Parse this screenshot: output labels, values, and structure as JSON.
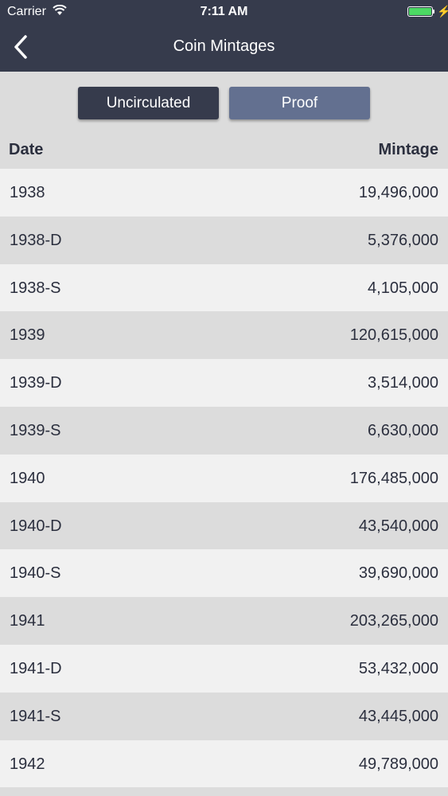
{
  "status": {
    "carrier": "Carrier",
    "time": "7:11 AM"
  },
  "nav": {
    "title": "Coin Mintages"
  },
  "segments": {
    "uncirculated": "Uncirculated",
    "proof": "Proof",
    "selected": "Uncirculated"
  },
  "table": {
    "headers": {
      "date": "Date",
      "mintage": "Mintage"
    },
    "rows": [
      {
        "date": "1938",
        "mintage": "19,496,000"
      },
      {
        "date": "1938-D",
        "mintage": "5,376,000"
      },
      {
        "date": "1938-S",
        "mintage": "4,105,000"
      },
      {
        "date": "1939",
        "mintage": "120,615,000"
      },
      {
        "date": "1939-D",
        "mintage": "3,514,000"
      },
      {
        "date": "1939-S",
        "mintage": "6,630,000"
      },
      {
        "date": "1940",
        "mintage": "176,485,000"
      },
      {
        "date": "1940-D",
        "mintage": "43,540,000"
      },
      {
        "date": "1940-S",
        "mintage": "39,690,000"
      },
      {
        "date": "1941",
        "mintage": "203,265,000"
      },
      {
        "date": "1941-D",
        "mintage": "53,432,000"
      },
      {
        "date": "1941-S",
        "mintage": "43,445,000"
      },
      {
        "date": "1942",
        "mintage": "49,789,000"
      }
    ]
  },
  "colors": {
    "nav": "#363b4c",
    "selected_segment": "#363b4c",
    "unselected_segment": "#637090",
    "battery": "#4cd964"
  }
}
